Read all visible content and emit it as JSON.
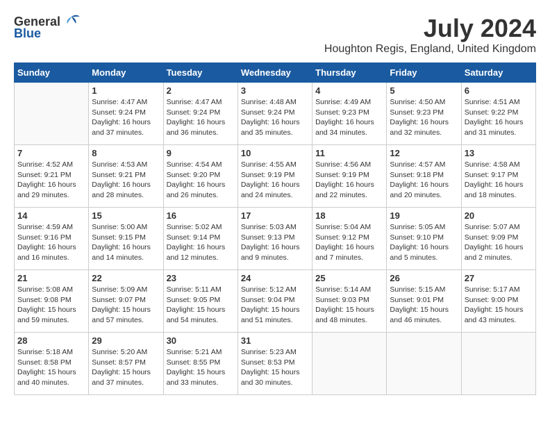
{
  "logo": {
    "general": "General",
    "blue": "Blue"
  },
  "title": {
    "month": "July 2024",
    "location": "Houghton Regis, England, United Kingdom"
  },
  "days_of_week": [
    "Sunday",
    "Monday",
    "Tuesday",
    "Wednesday",
    "Thursday",
    "Friday",
    "Saturday"
  ],
  "weeks": [
    [
      {
        "day": null,
        "info": null
      },
      {
        "day": "1",
        "sunrise": "4:47 AM",
        "sunset": "9:24 PM",
        "daylight": "16 hours and 37 minutes."
      },
      {
        "day": "2",
        "sunrise": "4:47 AM",
        "sunset": "9:24 PM",
        "daylight": "16 hours and 36 minutes."
      },
      {
        "day": "3",
        "sunrise": "4:48 AM",
        "sunset": "9:24 PM",
        "daylight": "16 hours and 35 minutes."
      },
      {
        "day": "4",
        "sunrise": "4:49 AM",
        "sunset": "9:23 PM",
        "daylight": "16 hours and 34 minutes."
      },
      {
        "day": "5",
        "sunrise": "4:50 AM",
        "sunset": "9:23 PM",
        "daylight": "16 hours and 32 minutes."
      },
      {
        "day": "6",
        "sunrise": "4:51 AM",
        "sunset": "9:22 PM",
        "daylight": "16 hours and 31 minutes."
      }
    ],
    [
      {
        "day": "7",
        "sunrise": "4:52 AM",
        "sunset": "9:21 PM",
        "daylight": "16 hours and 29 minutes."
      },
      {
        "day": "8",
        "sunrise": "4:53 AM",
        "sunset": "9:21 PM",
        "daylight": "16 hours and 28 minutes."
      },
      {
        "day": "9",
        "sunrise": "4:54 AM",
        "sunset": "9:20 PM",
        "daylight": "16 hours and 26 minutes."
      },
      {
        "day": "10",
        "sunrise": "4:55 AM",
        "sunset": "9:19 PM",
        "daylight": "16 hours and 24 minutes."
      },
      {
        "day": "11",
        "sunrise": "4:56 AM",
        "sunset": "9:19 PM",
        "daylight": "16 hours and 22 minutes."
      },
      {
        "day": "12",
        "sunrise": "4:57 AM",
        "sunset": "9:18 PM",
        "daylight": "16 hours and 20 minutes."
      },
      {
        "day": "13",
        "sunrise": "4:58 AM",
        "sunset": "9:17 PM",
        "daylight": "16 hours and 18 minutes."
      }
    ],
    [
      {
        "day": "14",
        "sunrise": "4:59 AM",
        "sunset": "9:16 PM",
        "daylight": "16 hours and 16 minutes."
      },
      {
        "day": "15",
        "sunrise": "5:00 AM",
        "sunset": "9:15 PM",
        "daylight": "16 hours and 14 minutes."
      },
      {
        "day": "16",
        "sunrise": "5:02 AM",
        "sunset": "9:14 PM",
        "daylight": "16 hours and 12 minutes."
      },
      {
        "day": "17",
        "sunrise": "5:03 AM",
        "sunset": "9:13 PM",
        "daylight": "16 hours and 9 minutes."
      },
      {
        "day": "18",
        "sunrise": "5:04 AM",
        "sunset": "9:12 PM",
        "daylight": "16 hours and 7 minutes."
      },
      {
        "day": "19",
        "sunrise": "5:05 AM",
        "sunset": "9:10 PM",
        "daylight": "16 hours and 5 minutes."
      },
      {
        "day": "20",
        "sunrise": "5:07 AM",
        "sunset": "9:09 PM",
        "daylight": "16 hours and 2 minutes."
      }
    ],
    [
      {
        "day": "21",
        "sunrise": "5:08 AM",
        "sunset": "9:08 PM",
        "daylight": "15 hours and 59 minutes."
      },
      {
        "day": "22",
        "sunrise": "5:09 AM",
        "sunset": "9:07 PM",
        "daylight": "15 hours and 57 minutes."
      },
      {
        "day": "23",
        "sunrise": "5:11 AM",
        "sunset": "9:05 PM",
        "daylight": "15 hours and 54 minutes."
      },
      {
        "day": "24",
        "sunrise": "5:12 AM",
        "sunset": "9:04 PM",
        "daylight": "15 hours and 51 minutes."
      },
      {
        "day": "25",
        "sunrise": "5:14 AM",
        "sunset": "9:03 PM",
        "daylight": "15 hours and 48 minutes."
      },
      {
        "day": "26",
        "sunrise": "5:15 AM",
        "sunset": "9:01 PM",
        "daylight": "15 hours and 46 minutes."
      },
      {
        "day": "27",
        "sunrise": "5:17 AM",
        "sunset": "9:00 PM",
        "daylight": "15 hours and 43 minutes."
      }
    ],
    [
      {
        "day": "28",
        "sunrise": "5:18 AM",
        "sunset": "8:58 PM",
        "daylight": "15 hours and 40 minutes."
      },
      {
        "day": "29",
        "sunrise": "5:20 AM",
        "sunset": "8:57 PM",
        "daylight": "15 hours and 37 minutes."
      },
      {
        "day": "30",
        "sunrise": "5:21 AM",
        "sunset": "8:55 PM",
        "daylight": "15 hours and 33 minutes."
      },
      {
        "day": "31",
        "sunrise": "5:23 AM",
        "sunset": "8:53 PM",
        "daylight": "15 hours and 30 minutes."
      },
      {
        "day": null,
        "info": null
      },
      {
        "day": null,
        "info": null
      },
      {
        "day": null,
        "info": null
      }
    ]
  ],
  "labels": {
    "sunrise": "Sunrise:",
    "sunset": "Sunset:",
    "daylight": "Daylight:"
  }
}
